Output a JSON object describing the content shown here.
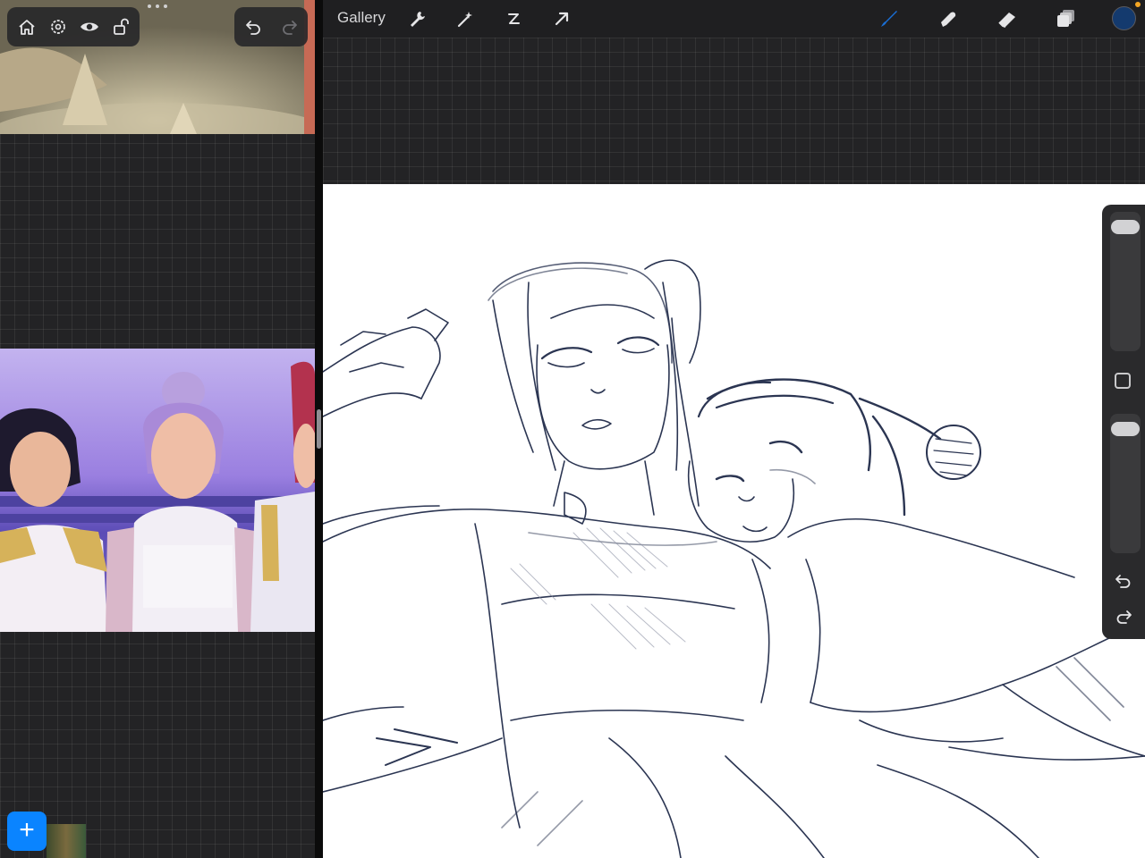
{
  "reference_pane": {
    "toolbar_icons": [
      "home-icon",
      "settings-icon",
      "eye-icon",
      "unlock-icon"
    ],
    "history_icons": [
      "undo-icon",
      "redo-icon"
    ],
    "add_label": "+"
  },
  "toolbar": {
    "gallery_label": "Gallery",
    "action_icons": [
      "wrench-icon",
      "magic-wand-icon",
      "selection-icon",
      "transform-arrow-icon"
    ],
    "tool_icons": [
      "brush-icon",
      "smudge-icon",
      "eraser-icon",
      "layers-icon"
    ],
    "active_tool": "brush",
    "current_color": "#143a6e",
    "accent_color": "#1a6fd6"
  },
  "sidebar": {
    "brush_size": 0.95,
    "opacity": 0.95,
    "icons": [
      "modify-square-icon",
      "undo-icon",
      "redo-icon"
    ]
  }
}
